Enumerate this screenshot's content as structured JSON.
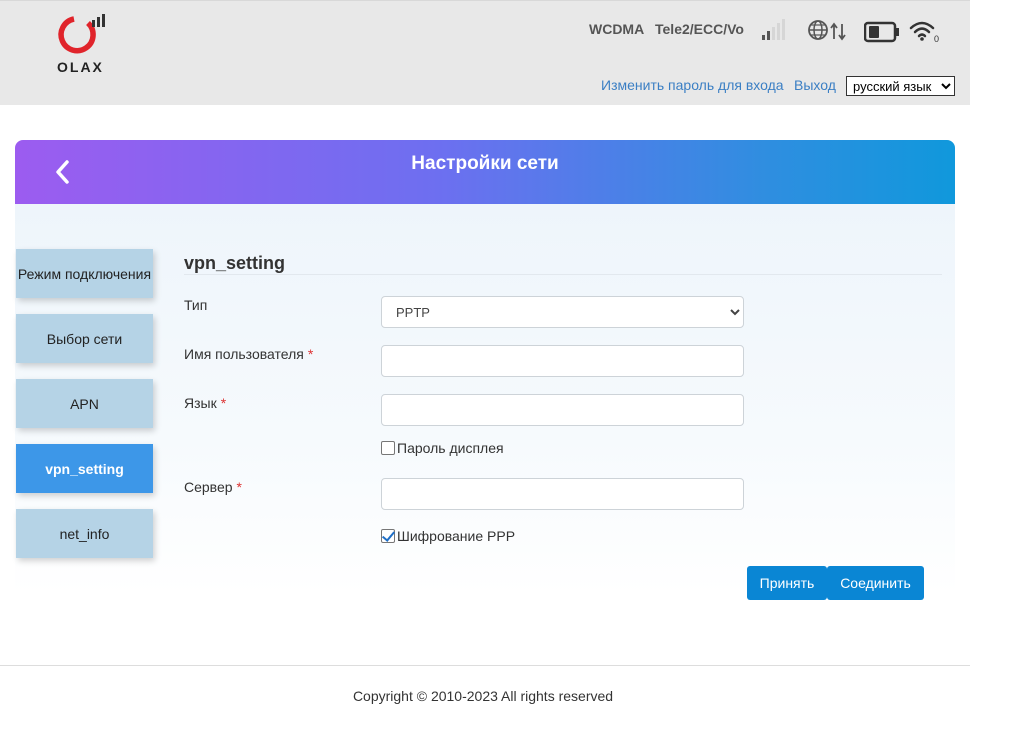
{
  "header": {
    "brand": "OLAX",
    "network_type": "WCDMA",
    "operator": "Tele2/ECC/Vo",
    "change_password_link": "Изменить пароль для входа",
    "logout_link": "Выход",
    "language": {
      "selected": "русский язык",
      "options": [
        "русский язык"
      ]
    },
    "icons": [
      "signal-icon",
      "globe-transfer-icon",
      "battery-icon",
      "wifi-icon"
    ]
  },
  "banner": {
    "title": "Настройки сети"
  },
  "sidebar": {
    "items": [
      {
        "label": "Режим подключения",
        "active": false
      },
      {
        "label": "Выбор сети",
        "active": false
      },
      {
        "label": "APN",
        "active": false
      },
      {
        "label": "vpn_setting",
        "active": true
      },
      {
        "label": "net_info",
        "active": false
      }
    ]
  },
  "form": {
    "section_title": "vpn_setting",
    "type_label": "Тип",
    "type_value": "PPTP",
    "username_label": "Имя пользователя",
    "username_value": "",
    "password_label": "Язык",
    "password_value": "",
    "show_password_label": "Пароль дисплея",
    "show_password_checked": false,
    "server_label": "Сервер",
    "server_value": "",
    "ppp_encryption_label": "Шифрование PPP",
    "ppp_encryption_checked": true,
    "required_mark": "*",
    "accept_button": "Принять",
    "connect_button": "Соединить"
  },
  "footer": {
    "copyright": "Copyright © 2010-2023 All rights reserved"
  },
  "colors": {
    "accent": "#0a86d4",
    "sidebar_active": "#3d97e8",
    "sidebar_item": "#b5d3e6",
    "banner_start": "#9c5cf0",
    "banner_end": "#1098dc",
    "logo_red": "#e0242b",
    "link": "#3b7fc4"
  }
}
